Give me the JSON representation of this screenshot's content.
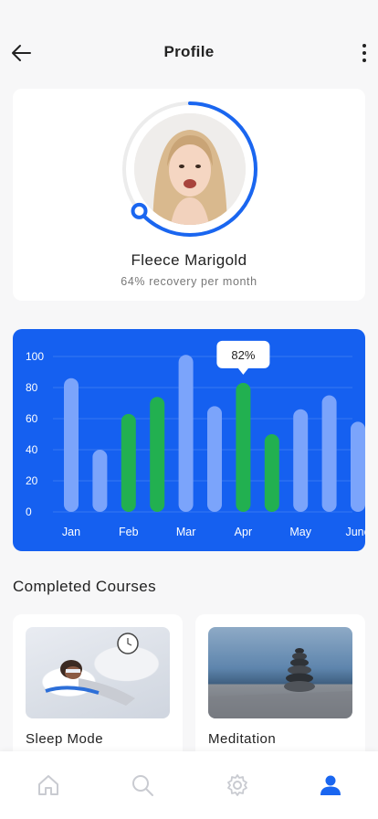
{
  "header": {
    "title": "Profile",
    "back_icon": "arrow-left-icon",
    "menu_icon": "more-vertical-icon"
  },
  "profile": {
    "name": "Fleece Marigold",
    "subtitle": "64% recovery per month",
    "progress": 0.64,
    "ring_color": "#1a66f0"
  },
  "chart_data": {
    "type": "bar",
    "title": "",
    "xlabel": "",
    "ylabel": "",
    "ylim": [
      0,
      100
    ],
    "yticks": [
      0,
      20,
      40,
      60,
      80,
      100
    ],
    "grid": true,
    "x_tick_labels": [
      "Jan",
      "Feb",
      "Mar",
      "Apr",
      "May",
      "June"
    ],
    "values": [
      86,
      40,
      63,
      74,
      101,
      68,
      83,
      50,
      66,
      75,
      58
    ],
    "highlight": [
      false,
      false,
      true,
      true,
      false,
      false,
      true,
      true,
      false,
      false,
      false
    ],
    "tooltip": {
      "bar_index": 6,
      "label": "82%"
    },
    "colors": {
      "background": "#1560f0",
      "bar": "#7ba4fb",
      "highlight": "#22b050"
    }
  },
  "courses": {
    "title": "Completed Courses",
    "items": [
      {
        "label": "Sleep Mode"
      },
      {
        "label": "Meditation"
      }
    ]
  },
  "nav": {
    "items": [
      {
        "icon": "home-icon",
        "active": false
      },
      {
        "icon": "search-icon",
        "active": false
      },
      {
        "icon": "settings-icon",
        "active": false
      },
      {
        "icon": "user-icon",
        "active": true
      }
    ],
    "active_color": "#1a66f0",
    "inactive_color": "#c9cbd1"
  }
}
